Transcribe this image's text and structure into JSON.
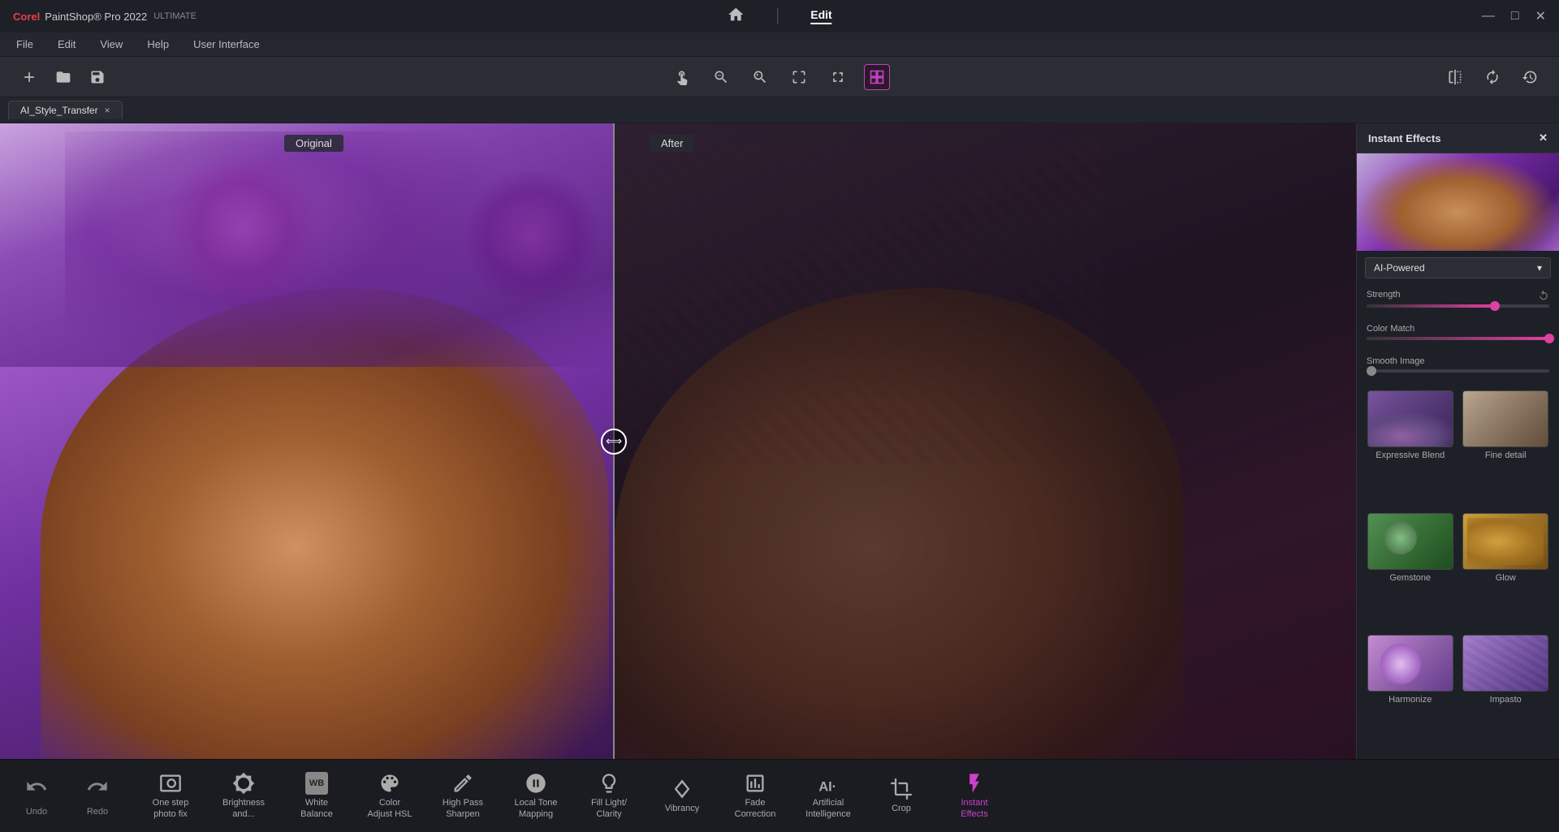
{
  "app": {
    "title": "Corel® PaintShop® Pro 2022 ULTIMATE",
    "brand": "Corel®",
    "product": "PaintShop® Pro 2022",
    "edition": "ULTIMATE"
  },
  "title_bar": {
    "home_label": "⌂",
    "edit_label": "Edit",
    "minimize": "—",
    "maximize": "□",
    "close": "✕"
  },
  "menu": {
    "items": [
      "File",
      "Edit",
      "View",
      "Help",
      "User Interface"
    ]
  },
  "tab": {
    "name": "AI_Style_Transfer",
    "close": "×"
  },
  "canvas": {
    "label_original": "Original",
    "label_after": "After"
  },
  "instant_effects": {
    "panel_title": "Instant Effects",
    "close": "✕",
    "dropdown": "AI-Powered",
    "strength_label": "Strength",
    "color_match_label": "Color Match",
    "smooth_image_label": "Smooth Image",
    "effects": [
      {
        "name": "Expressive Blend",
        "class": "thumb-expressive-blend"
      },
      {
        "name": "Fine detail",
        "class": "thumb-fine-detail"
      },
      {
        "name": "Gemstone",
        "class": "thumb-gemstone"
      },
      {
        "name": "Glow",
        "class": "thumb-glow"
      },
      {
        "name": "Harmonize",
        "class": "thumb-harmonize"
      },
      {
        "name": "Impasto",
        "class": "thumb-impasto"
      }
    ]
  },
  "bottom_tools": {
    "undo_label": "Undo",
    "redo_label": "Redo",
    "tools": [
      {
        "id": "one-step-photo",
        "label": "One step\nphoto fix",
        "icon": "photo"
      },
      {
        "id": "brightness",
        "label": "Brightness\nand...",
        "icon": "brightness"
      },
      {
        "id": "white-balance",
        "label": "White\nBalance",
        "icon": "wb"
      },
      {
        "id": "color-adjust-hsl",
        "label": "Color\nAdjust HSL",
        "icon": "color"
      },
      {
        "id": "high-pass-sharpen",
        "label": "High Pass\nSharpen",
        "icon": "sharpen"
      },
      {
        "id": "local-tone-mapping",
        "label": "Local Tone\nMapping",
        "icon": "tone"
      },
      {
        "id": "fill-light-clarity",
        "label": "Fill Light/\nClarity",
        "icon": "fill"
      },
      {
        "id": "vibrancy",
        "label": "Vibrancy",
        "icon": "vibrancy"
      },
      {
        "id": "fade-correction",
        "label": "Fade\nCorrection",
        "icon": "fade"
      },
      {
        "id": "artificial-intelligence",
        "label": "Artificial\nIntelligence",
        "icon": "ai"
      },
      {
        "id": "crop",
        "label": "Crop",
        "icon": "crop"
      },
      {
        "id": "instant-effects",
        "label": "Instant\nEffects",
        "icon": "effects",
        "active": true
      }
    ]
  }
}
